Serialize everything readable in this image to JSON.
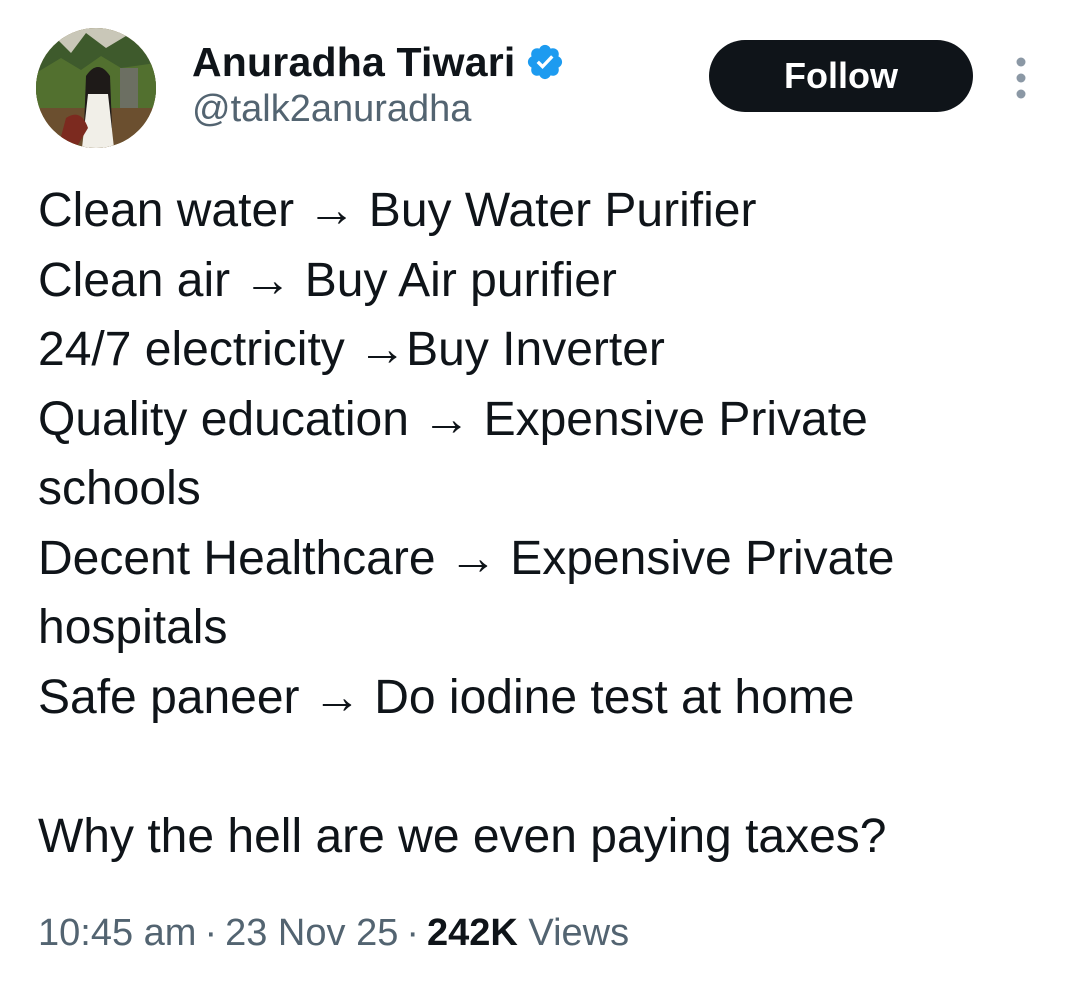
{
  "author": {
    "display_name": "Anuradha Tiwari",
    "handle": "@talk2anuradha",
    "verified": true,
    "verified_color": "#1d9bf0"
  },
  "actions": {
    "follow_label": "Follow",
    "more_icon": "more-vertical-icon"
  },
  "tweet": {
    "lines": [
      "Clean water → Buy Water Purifier",
      "Clean air →  Buy Air purifier",
      "24/7 electricity →Buy Inverter",
      "Quality education → Expensive Private",
      "schools",
      "Decent Healthcare → Expensive Private",
      "hospitals",
      "Safe paneer → Do iodine test at home",
      "",
      "Why the hell are we even paying taxes?"
    ]
  },
  "meta": {
    "time": "10:45 am",
    "separator": "·",
    "date": "23 Nov 25",
    "views_count": "242K",
    "views_label": "Views"
  },
  "colors": {
    "text_primary": "#0f1419",
    "text_secondary": "#536471",
    "button_bg": "#0f1419",
    "button_text": "#ffffff"
  }
}
